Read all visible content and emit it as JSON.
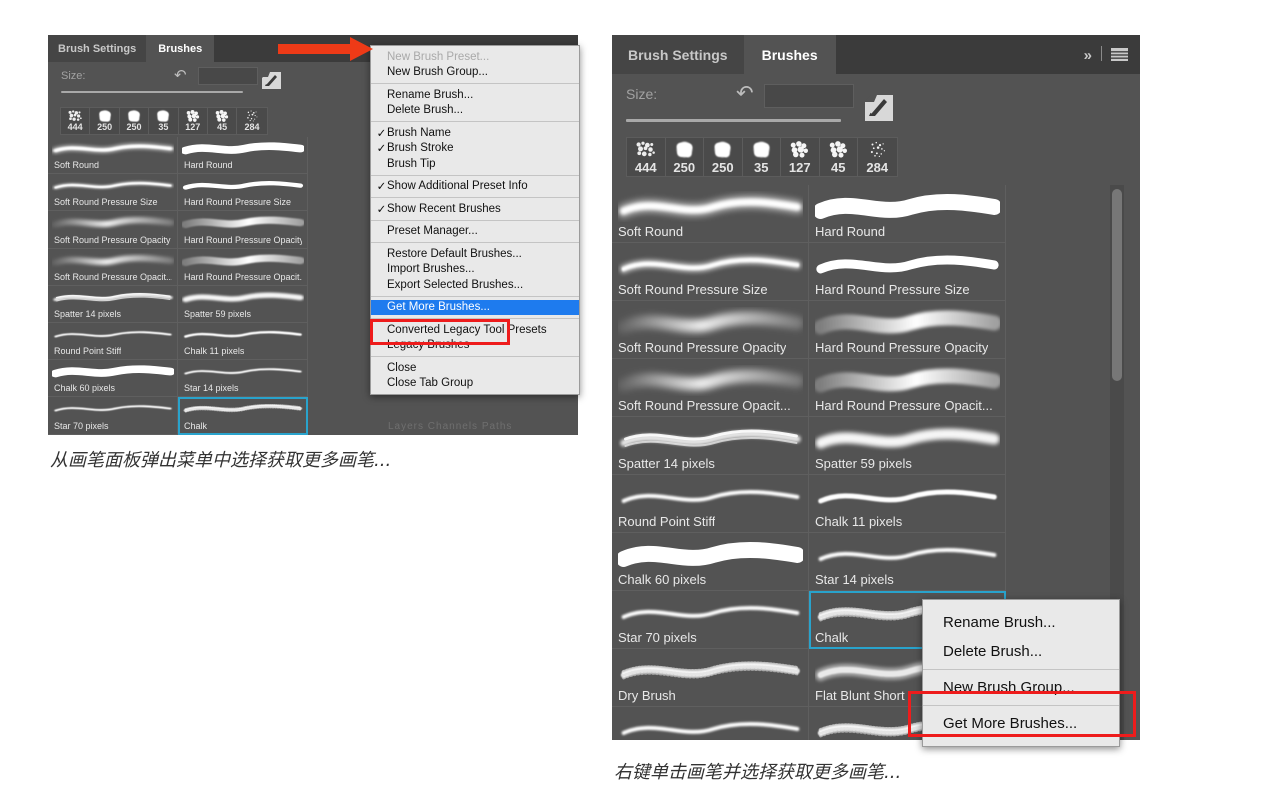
{
  "figure_left": {
    "panel": {
      "tabs": [
        {
          "label": "Brush Settings",
          "active": false
        },
        {
          "label": "Brushes",
          "active": true
        }
      ],
      "size_label": "Size:",
      "size_value": "",
      "reset_icon": "reset-arrow-icon",
      "folder_icon": "brush-folder-icon",
      "recent_thumbs": [
        {
          "label": "444",
          "kind": "scatter"
        },
        {
          "label": "250",
          "kind": "round"
        },
        {
          "label": "250",
          "kind": "round"
        },
        {
          "label": "35",
          "kind": "round"
        },
        {
          "label": "127",
          "kind": "chalk"
        },
        {
          "label": "45",
          "kind": "chalk"
        },
        {
          "label": "284",
          "kind": "spray"
        }
      ],
      "brushes": [
        {
          "name": "Soft Round",
          "kind": "soft",
          "selected": false
        },
        {
          "name": "Hard Round",
          "kind": "hard",
          "selected": false
        },
        {
          "name": "Soft Round Pressure Size",
          "kind": "soft-taper",
          "selected": false
        },
        {
          "name": "Hard Round Pressure Size",
          "kind": "hard-taper",
          "selected": false
        },
        {
          "name": "Soft Round Pressure Opacity",
          "kind": "soft-fade",
          "selected": false
        },
        {
          "name": "Hard Round Pressure Opacity",
          "kind": "hard-fade",
          "selected": false
        },
        {
          "name": "Soft Round Pressure Opacit...",
          "kind": "soft-fade",
          "selected": false
        },
        {
          "name": "Hard Round Pressure Opacit...",
          "kind": "hard-fade",
          "selected": false
        },
        {
          "name": "Spatter 14 pixels",
          "kind": "spatter",
          "selected": false
        },
        {
          "name": "Spatter 59 pixels",
          "kind": "spatter2",
          "selected": false
        },
        {
          "name": "Round Point Stiff",
          "kind": "thin",
          "selected": false
        },
        {
          "name": "Chalk 11 pixels",
          "kind": "thin2",
          "selected": false
        },
        {
          "name": "Chalk 60 pixels",
          "kind": "hard",
          "selected": false
        },
        {
          "name": "Star 14 pixels",
          "kind": "thin",
          "selected": false
        },
        {
          "name": "Star 70 pixels",
          "kind": "thin",
          "selected": false
        },
        {
          "name": "Chalk",
          "kind": "rough",
          "selected": true
        }
      ]
    },
    "menu": {
      "items": [
        {
          "label": "New Brush Preset...",
          "state": "disabled"
        },
        {
          "label": "New Brush Group...",
          "state": "normal"
        },
        {
          "type": "separator"
        },
        {
          "label": "Rename Brush...",
          "state": "normal"
        },
        {
          "label": "Delete Brush...",
          "state": "normal"
        },
        {
          "type": "separator"
        },
        {
          "label": "Brush Name",
          "state": "checked"
        },
        {
          "label": "Brush Stroke",
          "state": "checked"
        },
        {
          "label": "Brush Tip",
          "state": "normal"
        },
        {
          "type": "separator"
        },
        {
          "label": "Show Additional Preset Info",
          "state": "checked"
        },
        {
          "type": "separator"
        },
        {
          "label": "Show Recent Brushes",
          "state": "checked"
        },
        {
          "type": "separator"
        },
        {
          "label": "Preset Manager...",
          "state": "normal"
        },
        {
          "type": "separator"
        },
        {
          "label": "Restore Default Brushes...",
          "state": "normal"
        },
        {
          "label": "Import Brushes...",
          "state": "normal"
        },
        {
          "label": "Export Selected Brushes...",
          "state": "normal"
        },
        {
          "type": "separator"
        },
        {
          "label": "Get More Brushes...",
          "state": "highlighted"
        },
        {
          "type": "separator"
        },
        {
          "label": "Converted Legacy Tool Presets",
          "state": "normal"
        },
        {
          "label": "Legacy Brushes",
          "state": "normal"
        },
        {
          "type": "separator"
        },
        {
          "label": "Close",
          "state": "normal"
        },
        {
          "label": "Close Tab Group",
          "state": "normal"
        }
      ]
    },
    "cut_off_tabs": "Layers     Channels     Paths",
    "arrow": "red-arrow-pointing-right",
    "highlight_color": "#ee1c1c",
    "caption": "从画笔面板弹出菜单中选择获取更多画笔..."
  },
  "figure_right": {
    "panel": {
      "tabs": [
        {
          "label": "Brush Settings",
          "active": false
        },
        {
          "label": "Brushes",
          "active": true
        }
      ],
      "collapse_icon": "double-chevron-right-icon",
      "menu_icon": "hamburger-menu-icon",
      "size_label": "Size:",
      "size_value": "",
      "reset_icon": "reset-arrow-icon",
      "folder_icon": "brush-folder-icon",
      "recent_thumbs": [
        {
          "label": "444",
          "kind": "scatter"
        },
        {
          "label": "250",
          "kind": "round"
        },
        {
          "label": "250",
          "kind": "round"
        },
        {
          "label": "35",
          "kind": "round"
        },
        {
          "label": "127",
          "kind": "chalk"
        },
        {
          "label": "45",
          "kind": "chalk"
        },
        {
          "label": "284",
          "kind": "spray"
        }
      ],
      "brushes": [
        {
          "name": "Soft Round",
          "kind": "soft",
          "selected": false
        },
        {
          "name": "Hard Round",
          "kind": "hard",
          "selected": false
        },
        {
          "name": "Soft Round Pressure Size",
          "kind": "soft-taper",
          "selected": false
        },
        {
          "name": "Hard Round Pressure Size",
          "kind": "hard-taper",
          "selected": false
        },
        {
          "name": "Soft Round Pressure Opacity",
          "kind": "soft-fade",
          "selected": false
        },
        {
          "name": "Hard Round Pressure Opacity",
          "kind": "hard-fade",
          "selected": false
        },
        {
          "name": "Soft Round Pressure Opacit...",
          "kind": "soft-fade",
          "selected": false
        },
        {
          "name": "Hard Round Pressure Opacit...",
          "kind": "hard-fade",
          "selected": false
        },
        {
          "name": "Spatter 14 pixels",
          "kind": "spatter",
          "selected": false
        },
        {
          "name": "Spatter 59 pixels",
          "kind": "spatter2",
          "selected": false
        },
        {
          "name": "Round Point Stiff",
          "kind": "thin",
          "selected": false
        },
        {
          "name": "Chalk 11 pixels",
          "kind": "thin2",
          "selected": false
        },
        {
          "name": "Chalk 60 pixels",
          "kind": "hard",
          "selected": false
        },
        {
          "name": "Star 14 pixels",
          "kind": "thin",
          "selected": false
        },
        {
          "name": "Star 70 pixels",
          "kind": "thin",
          "selected": false
        },
        {
          "name": "Chalk",
          "kind": "rough",
          "selected": true
        },
        {
          "name": "Dry Brush",
          "kind": "rough",
          "selected": false
        },
        {
          "name": "Flat Blunt Short",
          "kind": "flat",
          "selected": false
        },
        {
          "name": "",
          "kind": "thin",
          "selected": false
        },
        {
          "name": "",
          "kind": "rough",
          "selected": false
        }
      ]
    },
    "context_menu": {
      "items": [
        {
          "label": "Rename Brush...",
          "state": "normal"
        },
        {
          "label": "Delete Brush...",
          "state": "normal"
        },
        {
          "type": "separator"
        },
        {
          "label": "New Brush Group...",
          "state": "normal"
        },
        {
          "type": "separator"
        },
        {
          "label": "Get More Brushes...",
          "state": "normal"
        }
      ]
    },
    "highlight_color": "#ee1c1c",
    "caption": "右键单击画笔并选择获取更多画笔..."
  }
}
